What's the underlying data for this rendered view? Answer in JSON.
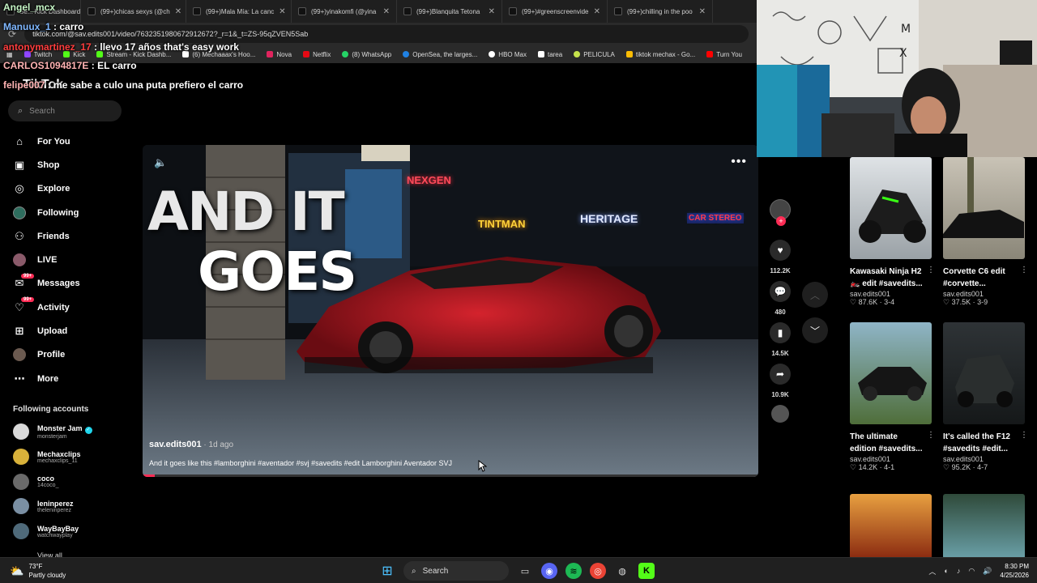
{
  "browser": {
    "tabs": [
      {
        "label": "Se... Kick Dashboard"
      },
      {
        "label": "(99+)chicas sexys (@ch"
      },
      {
        "label": "(99+)Mala Mía: La canc"
      },
      {
        "label": "(99+)yinakomfi (@yina"
      },
      {
        "label": "(99+)Blanquita Tetona"
      },
      {
        "label": "(99+)#greenscreenvide"
      },
      {
        "label": "(99+)chilling in the poo"
      }
    ],
    "url": "tiktok.com/@sav.edits001/video/7632351980672912672?_r=1&_t=ZS-95qZVEN5Sab",
    "bookmarks": [
      {
        "label": "Twitch",
        "color": "#9146ff"
      },
      {
        "label": "Kick",
        "color": "#53fc18"
      },
      {
        "label": "Stream - Kick Dashb...",
        "color": "#53fc18"
      },
      {
        "label": "(6) Mechaaax's Hoo...",
        "color": "#ffffff"
      },
      {
        "label": "Nova",
        "color": "#e0245e"
      },
      {
        "label": "Netflix",
        "color": "#e50914"
      },
      {
        "label": "(8) WhatsApp",
        "color": "#25d366"
      },
      {
        "label": "OpenSea, the larges...",
        "color": "#2081e2"
      },
      {
        "label": "HBO Max",
        "color": "#ffffff"
      },
      {
        "label": "tarea",
        "color": "#ffffff"
      },
      {
        "label": "PELICULA",
        "color": "#c6e34c"
      },
      {
        "label": "tiktok mechax - Go...",
        "color": "#fbbc04"
      },
      {
        "label": "Turn You",
        "color": "#ff0000"
      }
    ]
  },
  "chat": [
    {
      "user": "Angel_mcx",
      "text": ""
    },
    {
      "user": "Manuux_1",
      "text": ": carro"
    },
    {
      "user": "antonymartinez_17",
      "text": ": llevo 17 años that's easy work"
    },
    {
      "user": "CARLOS1094817E",
      "text": ": EL carro"
    },
    {
      "user": "felipe007",
      "text": ": me sabe a culo una puta prefiero el carro"
    }
  ],
  "sidebar": {
    "logo": "TikTok",
    "search_placeholder": "Search",
    "nav": [
      {
        "label": "For You",
        "icon": "home-icon"
      },
      {
        "label": "Shop",
        "icon": "shop-icon"
      },
      {
        "label": "Explore",
        "icon": "compass-icon"
      },
      {
        "label": "Following",
        "icon": "following-icon"
      },
      {
        "label": "Friends",
        "icon": "friends-icon"
      },
      {
        "label": "LIVE",
        "icon": "live-icon"
      },
      {
        "label": "Messages",
        "icon": "messages-icon",
        "badge": "99+"
      },
      {
        "label": "Activity",
        "icon": "activity-icon",
        "badge": "99+"
      },
      {
        "label": "Upload",
        "icon": "upload-icon"
      },
      {
        "label": "Profile",
        "icon": "profile-icon"
      },
      {
        "label": "More",
        "icon": "more-icon"
      }
    ],
    "following_title": "Following accounts",
    "following": [
      {
        "name": "Monster Jam",
        "handle": "monsterjam",
        "verified": true,
        "color": "#d9d9d9"
      },
      {
        "name": "Mechaxclips",
        "handle": "mechaxclips_11",
        "color": "#d8b13a"
      },
      {
        "name": "coco",
        "handle": "14coco_",
        "color": "#6a6a6a"
      },
      {
        "name": "leninperez",
        "handle": "theleninperez",
        "color": "#7a8fa3"
      },
      {
        "name": "WayBayBay",
        "handle": "watchwayplay",
        "color": "#4f6a7a"
      }
    ],
    "view_all": "View all"
  },
  "video": {
    "author": "sav.edits001",
    "time": " · 1d ago",
    "caption": "And it goes like this #lamborghini #aventador #svj #savedits #edit Lamborghini Aventador SVJ",
    "overlay_line1": "AND IT",
    "overlay_line2": "GOES",
    "sign_nexgen": "NEXGEN",
    "sign_tintman": "TINTMAN",
    "sign_heritage": "HERITAGE",
    "sign_carstereo": "CAR STEREO",
    "progress": 0.02
  },
  "actions": {
    "likes": "112.2K",
    "comments": "480",
    "saves": "14.5K",
    "shares": "10.9K"
  },
  "related": [
    {
      "title1": "Kawasaki Ninja H2",
      "title2": "🏍️ edit #savedits...",
      "author": "sav.edits001",
      "views": "87.6K",
      "dur": "3-4"
    },
    {
      "title1": "Corvette C6 edit",
      "title2": "#corvette...",
      "author": "sav.edits001",
      "views": "37.5K",
      "dur": "3-9"
    },
    {
      "title1": "The ultimate",
      "title2": "edition #savedits...",
      "author": "sav.edits001",
      "views": "14.2K",
      "dur": "4-1"
    },
    {
      "title1": "It's called the F12",
      "title2": "#savedits #edit...",
      "author": "sav.edits001",
      "views": "95.2K",
      "dur": "4-7"
    }
  ],
  "taskbar": {
    "temp": "73°F",
    "weather": "Partly cloudy",
    "search": "Search",
    "time": "8:30 PM",
    "date": "4/25/2026"
  }
}
